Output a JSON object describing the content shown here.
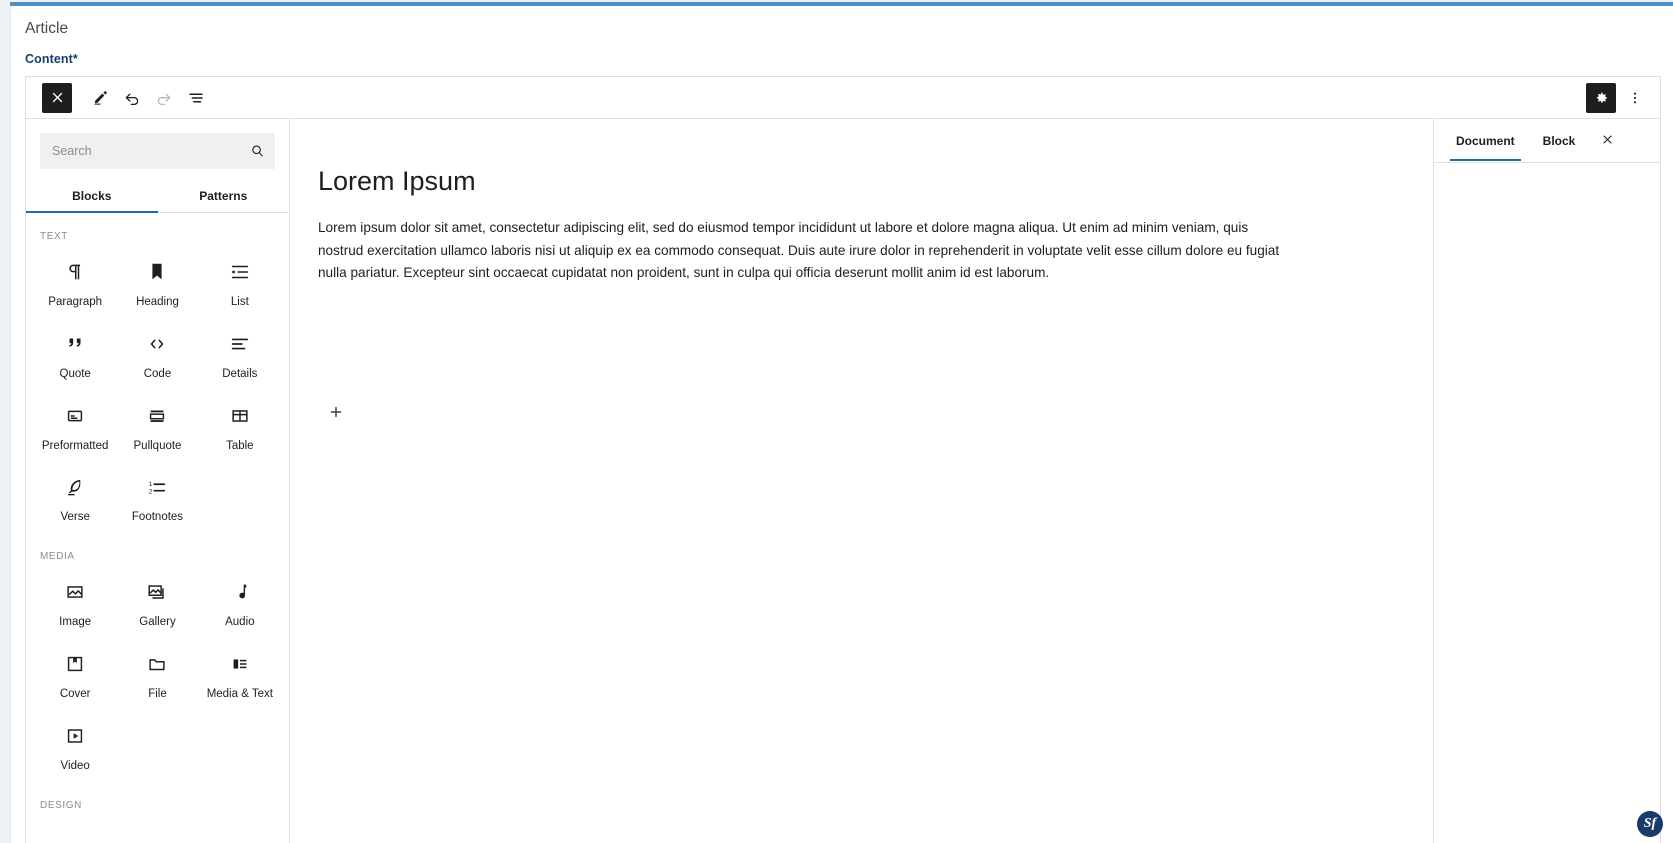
{
  "header": {
    "article_title": "Article",
    "content_label": "Content*"
  },
  "toolbar": {
    "close_label": "close-editor",
    "edit_label": "edit-tool",
    "undo_label": "undo",
    "redo_label": "redo",
    "list_view_label": "list-view",
    "settings_label": "settings",
    "options_label": "options"
  },
  "inserter": {
    "search_placeholder": "Search",
    "search_value": "",
    "tabs": [
      {
        "label": "Blocks",
        "active": true
      },
      {
        "label": "Patterns",
        "active": false
      }
    ],
    "groups": [
      {
        "title": "TEXT",
        "blocks": [
          {
            "label": "Paragraph",
            "icon": "paragraph-icon"
          },
          {
            "label": "Heading",
            "icon": "heading-icon"
          },
          {
            "label": "List",
            "icon": "list-icon"
          },
          {
            "label": "Quote",
            "icon": "quote-icon"
          },
          {
            "label": "Code",
            "icon": "code-icon"
          },
          {
            "label": "Details",
            "icon": "details-icon"
          },
          {
            "label": "Preformatted",
            "icon": "preformatted-icon"
          },
          {
            "label": "Pullquote",
            "icon": "pullquote-icon"
          },
          {
            "label": "Table",
            "icon": "table-icon"
          },
          {
            "label": "Verse",
            "icon": "verse-icon"
          },
          {
            "label": "Footnotes",
            "icon": "footnotes-icon"
          }
        ]
      },
      {
        "title": "MEDIA",
        "blocks": [
          {
            "label": "Image",
            "icon": "image-icon"
          },
          {
            "label": "Gallery",
            "icon": "gallery-icon"
          },
          {
            "label": "Audio",
            "icon": "audio-icon"
          },
          {
            "label": "Cover",
            "icon": "cover-icon"
          },
          {
            "label": "File",
            "icon": "file-icon"
          },
          {
            "label": "Media & Text",
            "icon": "media-text-icon"
          },
          {
            "label": "Video",
            "icon": "video-icon"
          }
        ]
      },
      {
        "title": "DESIGN",
        "blocks": []
      }
    ]
  },
  "canvas": {
    "post_title": "Lorem Ipsum",
    "paragraph": "Lorem ipsum dolor sit amet, consectetur adipiscing elit, sed do eiusmod tempor incididunt ut labore et dolore magna aliqua. Ut enim ad minim veniam, quis nostrud exercitation ullamco laboris nisi ut aliquip ex ea commodo consequat. Duis aute irure dolor in reprehenderit in voluptate velit esse cillum dolore eu fugiat nulla pariatur. Excepteur sint occaecat cupidatat non proident, sunt in culpa qui officia deserunt mollit anim id est laborum.",
    "appender_label": "+"
  },
  "settings": {
    "tabs": [
      {
        "label": "Document",
        "active": true
      },
      {
        "label": "Block",
        "active": false
      }
    ],
    "close_label": "close-settings"
  },
  "branding": {
    "badge_text": "Sf"
  },
  "colors": {
    "accent_blue": "#1d6ca3",
    "top_bar_blue": "#4b92c0",
    "label_navy": "#17406b",
    "toolbar_dark": "#1e1e1e",
    "page_bg": "#eef2f6",
    "symfony_navy": "#1a3a6b"
  }
}
